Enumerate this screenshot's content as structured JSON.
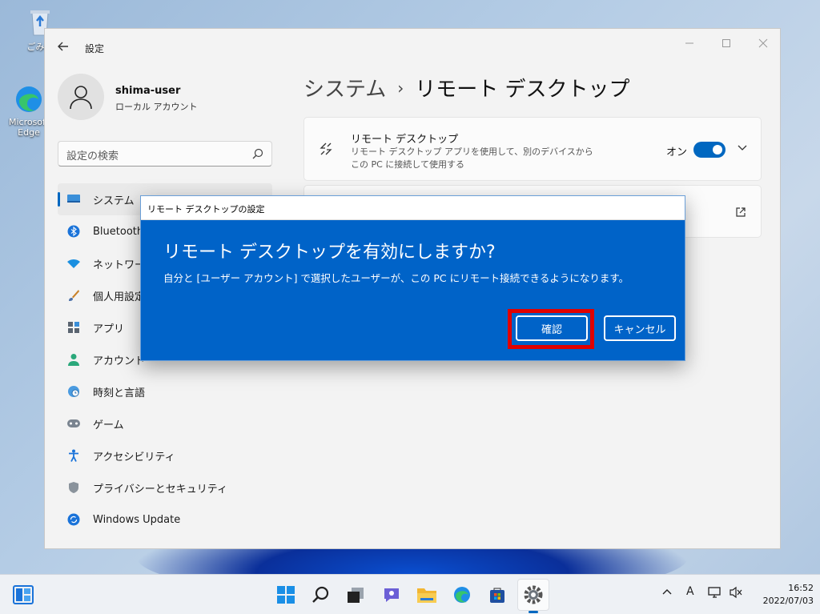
{
  "desktop": {
    "icons": [
      {
        "label": "ごみ箱"
      },
      {
        "label": "Microsoft Edge"
      }
    ]
  },
  "window": {
    "title": "設定",
    "profile": {
      "name": "shima-user",
      "account_type": "ローカル アカウント"
    },
    "search": {
      "placeholder": "設定の検索"
    },
    "nav": [
      {
        "label": "システム",
        "icon": "display-icon",
        "active": true
      },
      {
        "label": "Bluetooth",
        "icon": "bluetooth-icon"
      },
      {
        "label": "ネットワーク",
        "icon": "wifi-icon"
      },
      {
        "label": "個人用設定",
        "icon": "brush-icon"
      },
      {
        "label": "アプリ",
        "icon": "apps-icon"
      },
      {
        "label": "アカウント",
        "icon": "person-icon"
      },
      {
        "label": "時刻と言語",
        "icon": "clock-globe-icon"
      },
      {
        "label": "ゲーム",
        "icon": "gamepad-icon"
      },
      {
        "label": "アクセシビリティ",
        "icon": "accessibility-icon"
      },
      {
        "label": "プライバシーとセキュリティ",
        "icon": "shield-icon"
      },
      {
        "label": "Windows Update",
        "icon": "update-icon"
      }
    ],
    "breadcrumb": {
      "parent": "システム",
      "separator": "›",
      "current": "リモート デスクトップ"
    },
    "remote_card": {
      "title": "リモート デスクトップ",
      "description": "リモート デスクトップ アプリを使用して、別のデバイスからこの PC に接続して使用する",
      "toggle_label": "オン",
      "toggle_on": true
    }
  },
  "dialog": {
    "title": "リモート デスクトップの設定",
    "heading": "リモート デスクトップを有効にしますか?",
    "message": "自分と [ユーザー アカウント] で選択したユーザーが、この PC にリモート接続できるようになります。",
    "confirm_label": "確認",
    "cancel_label": "キャンセル",
    "highlight_color": "#e00000"
  },
  "taskbar": {
    "apps": [
      "start-icon",
      "search-icon",
      "task-view-icon",
      "chat-icon",
      "file-explorer-icon",
      "edge-icon",
      "store-icon",
      "settings-icon"
    ],
    "tray": {
      "ime": "A"
    },
    "clock": {
      "time": "16:52",
      "date": "2022/07/03"
    }
  },
  "colors": {
    "accent": "#0067c0",
    "dialog_bg": "#0063c8"
  }
}
